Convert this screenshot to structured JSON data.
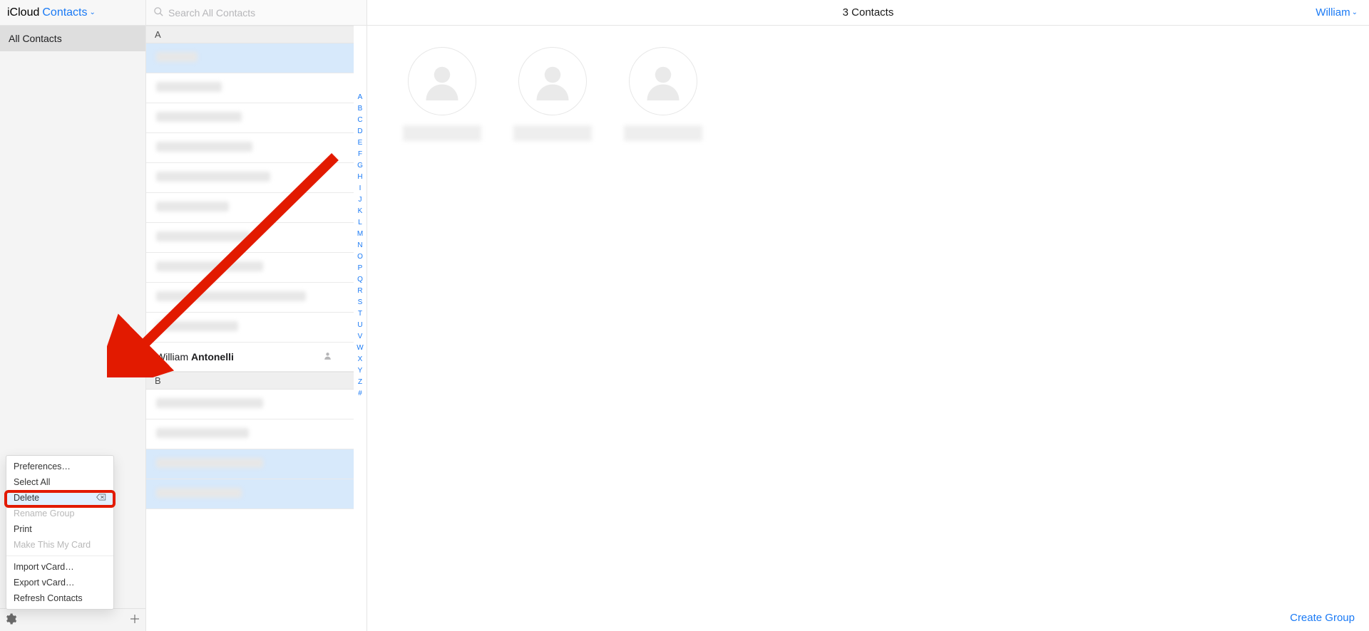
{
  "header": {
    "brand": "iCloud",
    "section": "Contacts",
    "search_placeholder": "Search All Contacts",
    "title": "3 Contacts",
    "account_name": "William"
  },
  "sidebar": {
    "groups": [
      {
        "label": "All Contacts",
        "active": true
      }
    ],
    "gear_menu": [
      {
        "label": "Preferences…",
        "type": "item"
      },
      {
        "label": "Select All",
        "type": "item"
      },
      {
        "label": "Delete",
        "type": "item",
        "highlight": true,
        "trailing_icon": "delete-icon"
      },
      {
        "label": "Rename Group",
        "type": "item",
        "disabled": true
      },
      {
        "label": "Print",
        "type": "item"
      },
      {
        "label": "Make This My Card",
        "type": "item",
        "disabled": true
      },
      {
        "type": "sep"
      },
      {
        "label": "Import vCard…",
        "type": "item"
      },
      {
        "label": "Export vCard…",
        "type": "item"
      },
      {
        "label": "Refresh Contacts",
        "type": "item"
      }
    ]
  },
  "list": {
    "sections": [
      {
        "letter": "A",
        "rows": [
          {
            "blur_width": 58,
            "selected": true
          },
          {
            "blur_width": 92
          },
          {
            "blur_width": 120
          },
          {
            "blur_width": 135
          },
          {
            "blur_width": 160
          },
          {
            "blur_width": 102
          },
          {
            "blur_width": 132
          },
          {
            "blur_width": 150
          },
          {
            "blur_width": 210
          },
          {
            "blur_width": 115
          },
          {
            "first": "William",
            "last": "Antonelli",
            "me": true
          }
        ]
      },
      {
        "letter": "B",
        "rows": [
          {
            "blur_width": 150
          },
          {
            "blur_width": 130
          },
          {
            "blur_width": 150,
            "selected": true
          },
          {
            "blur_width": 120,
            "selected": true
          }
        ]
      }
    ],
    "alpha_index": [
      "A",
      "B",
      "C",
      "D",
      "E",
      "F",
      "G",
      "H",
      "I",
      "J",
      "K",
      "L",
      "M",
      "N",
      "O",
      "P",
      "Q",
      "R",
      "S",
      "T",
      "U",
      "V",
      "W",
      "X",
      "Y",
      "Z",
      "#"
    ]
  },
  "detail": {
    "selected_count": 3,
    "create_group_label": "Create Group"
  },
  "annotation": {
    "target": "Delete",
    "color": "#e21a00"
  }
}
